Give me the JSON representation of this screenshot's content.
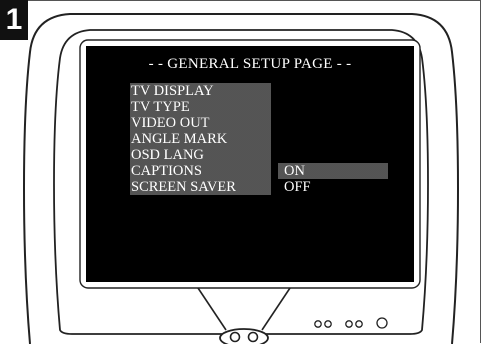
{
  "badge": {
    "number": "1"
  },
  "screen": {
    "title": "- - GENERAL SETUP PAGE - -",
    "menu": [
      {
        "label": "TV DISPLAY",
        "value": ""
      },
      {
        "label": "TV TYPE",
        "value": ""
      },
      {
        "label": "VIDEO OUT",
        "value": ""
      },
      {
        "label": "ANGLE MARK",
        "value": ""
      },
      {
        "label": "OSD LANG",
        "value": ""
      },
      {
        "label": "CAPTIONS",
        "value": "ON"
      },
      {
        "label": "SCREEN SAVER",
        "value": "OFF"
      }
    ]
  },
  "colors": {
    "screen_bg": "#000000",
    "menu_text": "#ffffff",
    "outline": "#222222"
  },
  "icons": [
    "tv-set-icon",
    "control-buttons-icon",
    "indicator-lights-icon"
  ]
}
